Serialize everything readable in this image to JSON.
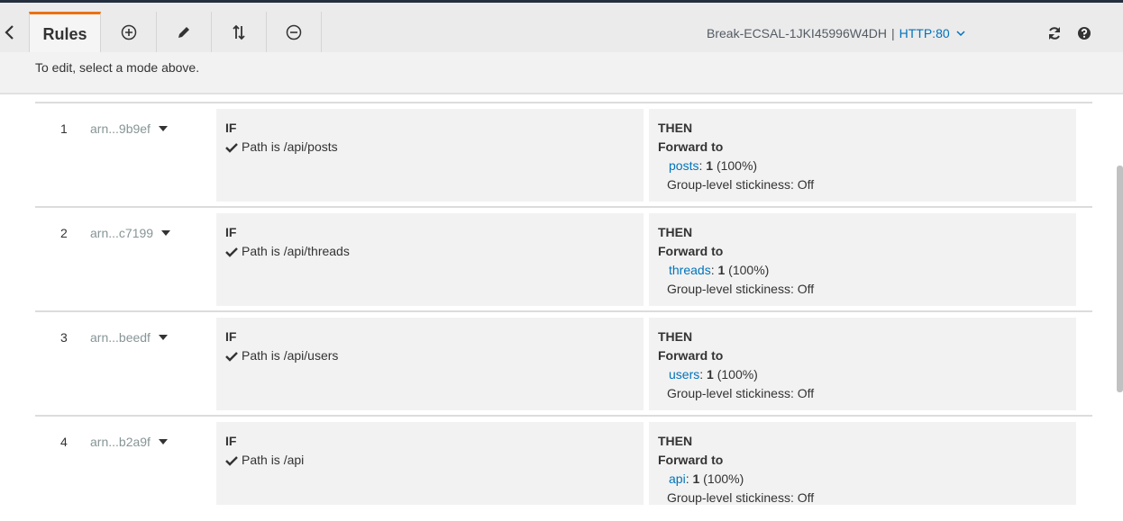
{
  "toolbar": {
    "active_tab": "Rules",
    "load_balancer": "Break-ECSAL-1JKI45996W4DH",
    "separator": "|",
    "listener": "HTTP:80",
    "buttons": [
      "add-icon",
      "edit-icon",
      "reorder-icon",
      "remove-icon"
    ]
  },
  "edit_hint": "To edit, select a mode above.",
  "rules": [
    {
      "num": "1",
      "arn": "arn...9b9ef",
      "if_label": "IF",
      "condition": "Path is /api/posts",
      "then_label": "THEN",
      "action": "Forward to",
      "target": "posts",
      "weight_sep": ":",
      "weight": "1",
      "percent": "(100%)",
      "stickiness": "Group-level stickiness: Off"
    },
    {
      "num": "2",
      "arn": "arn...c7199",
      "if_label": "IF",
      "condition": "Path is /api/threads",
      "then_label": "THEN",
      "action": "Forward to",
      "target": "threads",
      "weight_sep": ":",
      "weight": "1",
      "percent": "(100%)",
      "stickiness": "Group-level stickiness: Off"
    },
    {
      "num": "3",
      "arn": "arn...beedf",
      "if_label": "IF",
      "condition": "Path is /api/users",
      "then_label": "THEN",
      "action": "Forward to",
      "target": "users",
      "weight_sep": ":",
      "weight": "1",
      "percent": "(100%)",
      "stickiness": "Group-level stickiness: Off"
    },
    {
      "num": "4",
      "arn": "arn...b2a9f",
      "if_label": "IF",
      "condition": "Path is /api",
      "then_label": "THEN",
      "action": "Forward to",
      "target": "api",
      "weight_sep": ":",
      "weight": "1",
      "percent": "(100%)",
      "stickiness": "Group-level stickiness: Off"
    }
  ],
  "colors": {
    "accent": "#ec7211",
    "link": "#0073bb",
    "toolbar_bg": "#ebebeb",
    "box_bg": "#f2f2f2"
  }
}
